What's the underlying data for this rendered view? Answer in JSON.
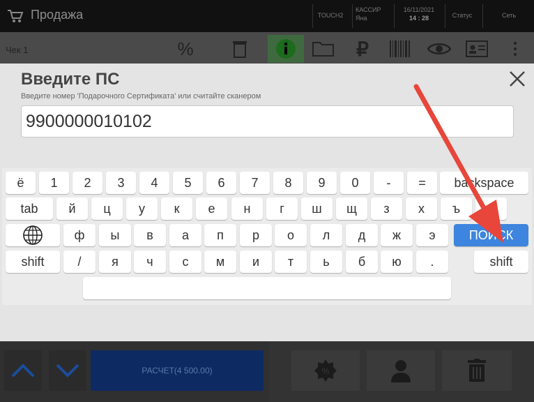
{
  "app": {
    "title": "Продажа",
    "header": {
      "terminal": "TOUCH2",
      "cashier_label": "КАССИР",
      "cashier_name": "Яна",
      "date": "16/11/2021",
      "time": "14 : 28",
      "status_label": "Статус",
      "network_label": "Сеть"
    },
    "check_label": "Чек 1",
    "toolbar_icons": [
      "percent-icon",
      "trash-icon",
      "info-icon",
      "folder-icon",
      "ruble-icon",
      "barcode-icon",
      "eye-icon",
      "id-card-icon",
      "more-icon"
    ],
    "pay_button": "РАСЧЕТ(4 500.00)"
  },
  "dialog": {
    "title": "Введите ПС",
    "subtitle": "Введите номер 'Подарочного Сертификата' или считайте сканером",
    "input_value": "9900000010102"
  },
  "keyboard": {
    "row1": [
      "ё",
      "1",
      "2",
      "3",
      "4",
      "5",
      "6",
      "7",
      "8",
      "9",
      "0",
      "-",
      "=",
      "backspace"
    ],
    "row2": [
      "tab",
      "й",
      "ц",
      "у",
      "к",
      "е",
      "н",
      "г",
      "ш",
      "щ",
      "з",
      "х",
      "ъ",
      "\\"
    ],
    "row3": [
      "ф",
      "ы",
      "в",
      "а",
      "п",
      "р",
      "о",
      "л",
      "д",
      "ж",
      "э",
      "ПОИСК"
    ],
    "row4": [
      "shift",
      "/",
      "я",
      "ч",
      "с",
      "м",
      "и",
      "т",
      "ь",
      "б",
      "ю",
      ".",
      "shift"
    ],
    "row5": [
      " "
    ]
  },
  "colors": {
    "accent": "#3d85de",
    "annotation_arrow": "#e8463a"
  }
}
